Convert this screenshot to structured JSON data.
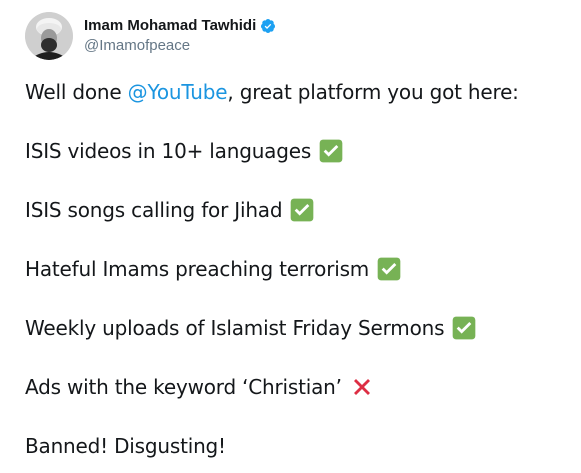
{
  "tweet": {
    "author": {
      "display_name": "Imam Mohamad Tawhidi",
      "handle": "@Imamofpeace",
      "verified": true
    },
    "lines": [
      {
        "pre": "Well done ",
        "mention": "@YouTube",
        "post": ", great platform you got here:"
      },
      {
        "text": "ISIS videos in 10+ languages",
        "emoji": "check-mark-emoji"
      },
      {
        "text": "ISIS songs calling for Jihad",
        "emoji": "check-mark-emoji"
      },
      {
        "text": "Hateful Imams preaching terrorism",
        "emoji": "check-mark-emoji"
      },
      {
        "text": "Weekly uploads of Islamist Friday Sermons",
        "emoji": "check-mark-emoji"
      },
      {
        "text": "Ads with the keyword ‘Christian’",
        "emoji": "cross-mark-emoji"
      },
      {
        "text": "Banned! Disgusting!"
      }
    ]
  },
  "colors": {
    "mention": "#1b95e0",
    "verified": "#1da1f2",
    "check_green": "#77b255",
    "cross_red": "#dd2e44",
    "handle_gray": "#657786"
  }
}
